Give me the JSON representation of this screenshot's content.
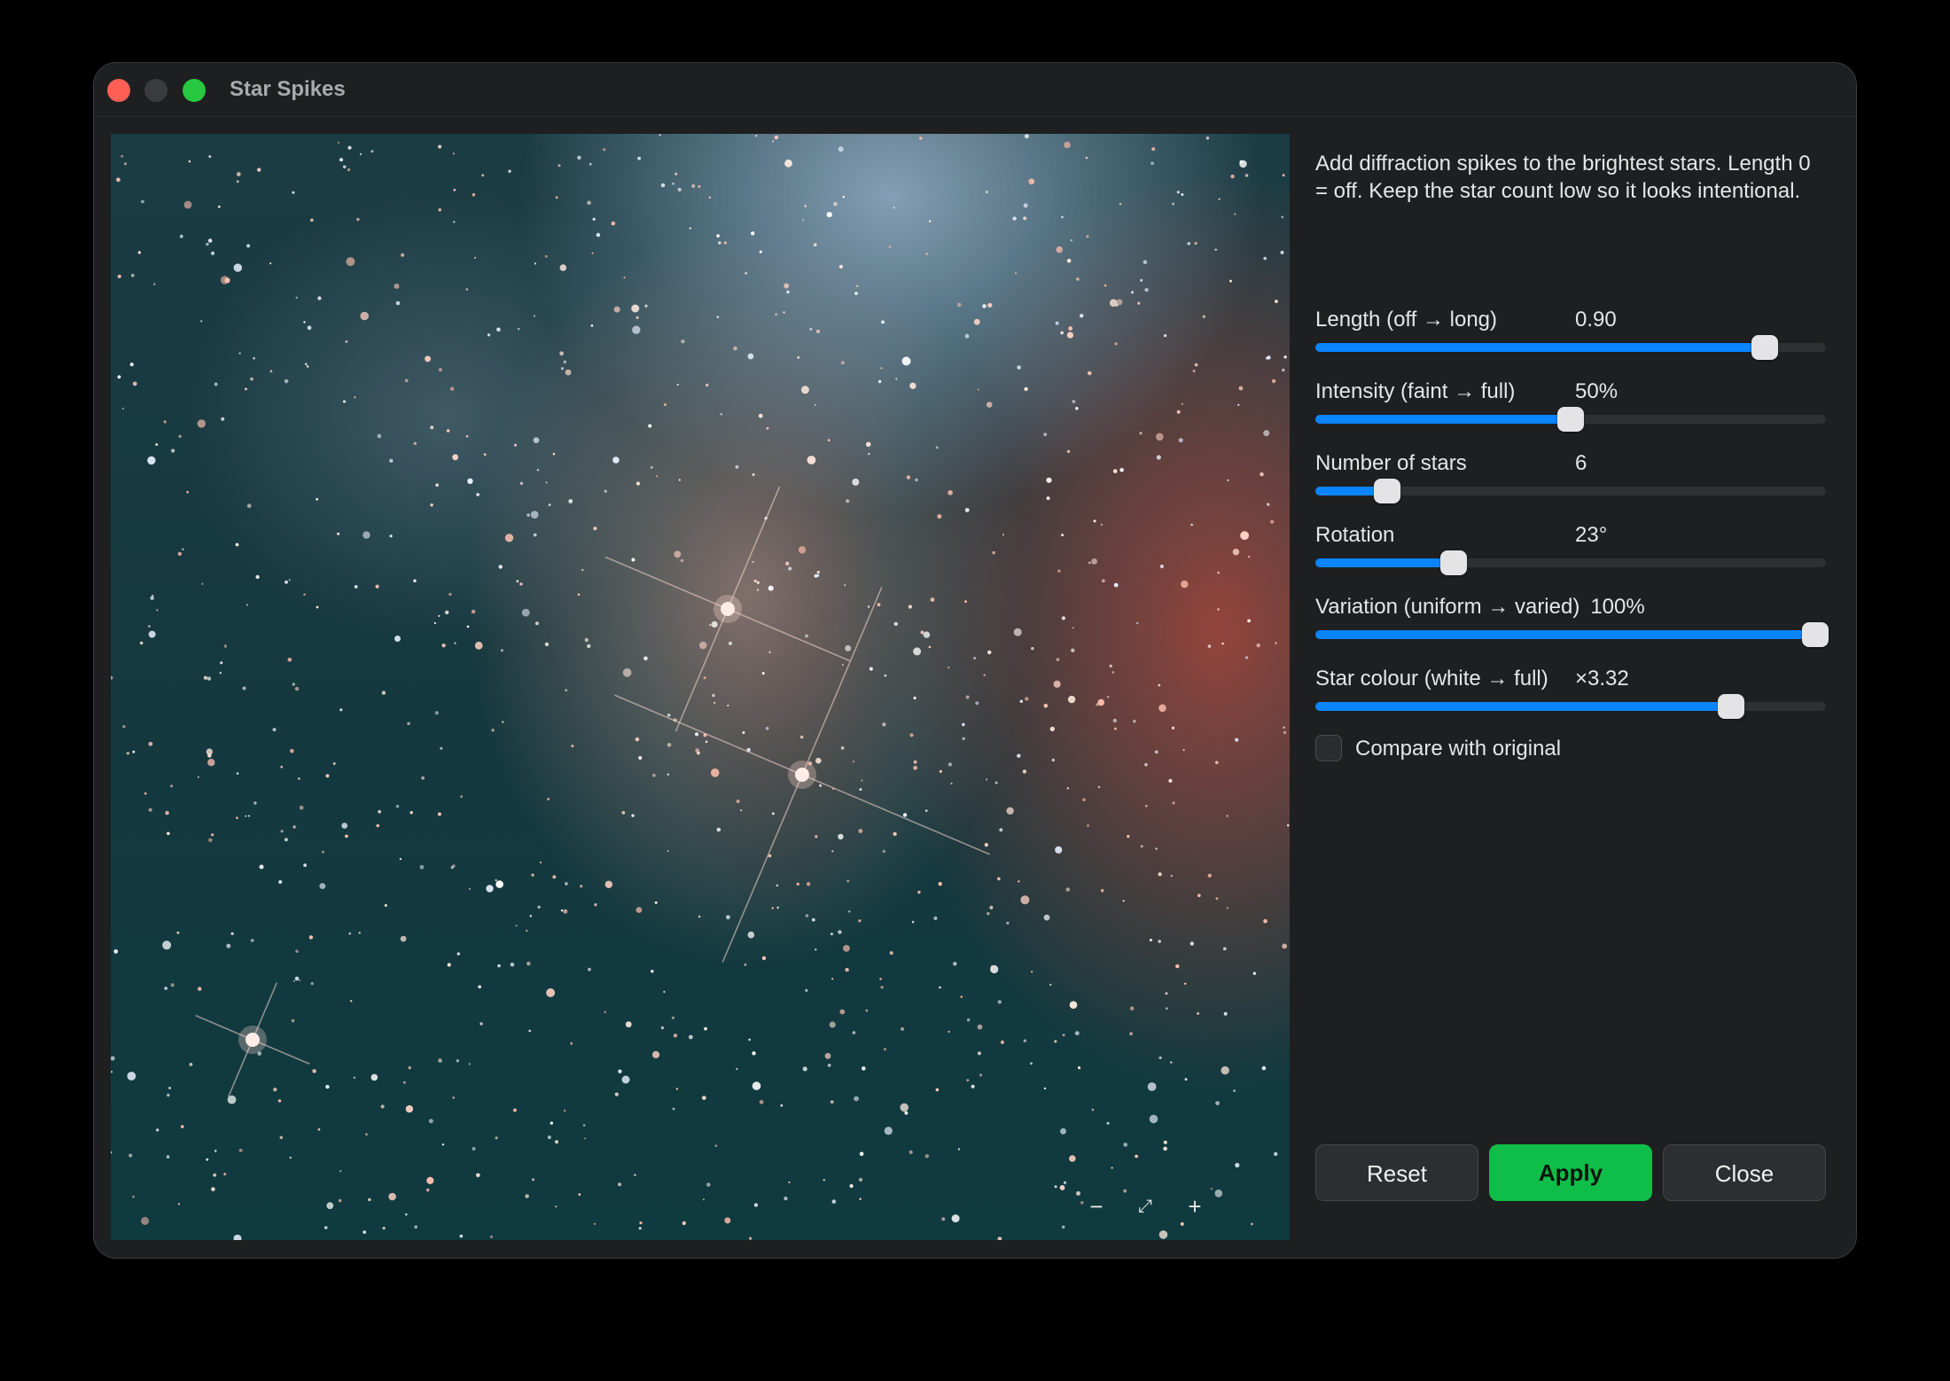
{
  "window": {
    "title": "Star Spikes"
  },
  "preview": {
    "zoom_out_label": "−",
    "fit_label": "⤢",
    "zoom_in_label": "+"
  },
  "panel": {
    "description": "Add diffraction spikes to the brightest stars. Length 0 = off. Keep the star count low so it looks intentional.",
    "controls": [
      {
        "label": "Length (off → long)",
        "value": "0.90",
        "fraction": 0.88
      },
      {
        "label": "Intensity (faint → full)",
        "value": "50%",
        "fraction": 0.5
      },
      {
        "label": "Number of stars",
        "value": "6",
        "fraction": 0.14
      },
      {
        "label": "Rotation",
        "value": "23°",
        "fraction": 0.27
      },
      {
        "label": "Variation (uniform → varied)",
        "value": "100%",
        "fraction": 0.98
      },
      {
        "label": "Star colour (white → full)",
        "value": "×3.32",
        "fraction": 0.815
      }
    ],
    "compare_label": "Compare with original",
    "compare_checked": false
  },
  "buttons": {
    "reset": "Reset",
    "apply": "Apply",
    "close": "Close"
  },
  "colors": {
    "accent": "#0a84ff",
    "apply": "#0fbe48",
    "close_dot": "#fe5f57",
    "max_dot": "#28c840"
  }
}
